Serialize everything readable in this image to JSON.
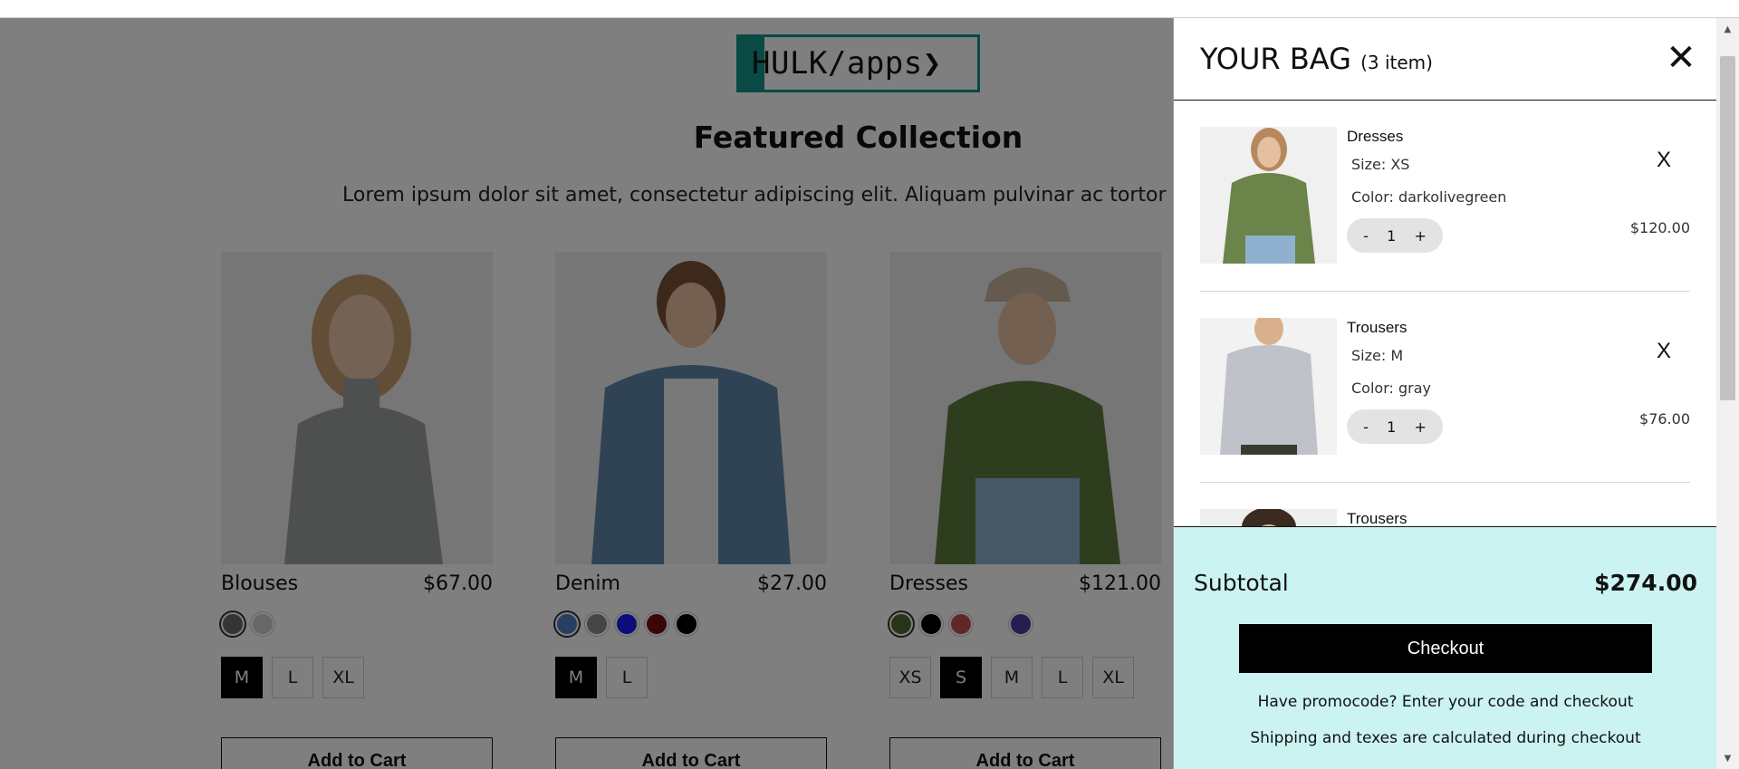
{
  "brand": {
    "logo_text": "HULK/apps❯"
  },
  "collection": {
    "title": "Featured Collection",
    "description": "Lorem ipsum dolor sit amet, consectetur adipiscing elit. Aliquam pulvinar ac tortor i"
  },
  "products": [
    {
      "name": "Blouses",
      "price": "$67.00",
      "swatches": [
        "#6b6b6b",
        "#cfcfcf"
      ],
      "selected_swatch": 0,
      "sizes": [
        "M",
        "L",
        "XL"
      ],
      "active_size": 0,
      "add_label": "Add to Cart"
    },
    {
      "name": "Denim",
      "price": "$27.00",
      "swatches": [
        "#4f7fc3",
        "#8a8a8a",
        "#1c17f5",
        "#7a0c0c",
        "#000000"
      ],
      "selected_swatch": 0,
      "sizes": [
        "M",
        "L"
      ],
      "active_size": 0,
      "add_label": "Add to Cart"
    },
    {
      "name": "Dresses",
      "price": "$121.00",
      "swatches": [
        "#4d6b2c",
        "#000000",
        "#c45050",
        "#ffffff",
        "#4a3c9c"
      ],
      "selected_swatch": 0,
      "sizes": [
        "XS",
        "S",
        "M",
        "L",
        "XL"
      ],
      "active_size": 1,
      "add_label": "Add to Cart"
    }
  ],
  "cart": {
    "title": "YOUR BAG",
    "count_label": "(3 item)",
    "close_glyph": "✕",
    "remove_glyph": "X",
    "items": [
      {
        "name": "Dresses",
        "size": "Size: XS",
        "color": "Color: darkolivegreen",
        "qty": "1",
        "price": "$120.00",
        "image": "green-shirt"
      },
      {
        "name": "Trousers",
        "size": "Size: M",
        "color": "Color: gray",
        "qty": "1",
        "price": "$76.00",
        "image": "gray-shirt"
      },
      {
        "name": "Trousers",
        "size": "",
        "color": "",
        "qty": "",
        "price": "",
        "image": "model-portrait"
      }
    ],
    "qty_minus": "-",
    "qty_plus": "+",
    "subtotal_label": "Subtotal",
    "subtotal_value": "$274.00",
    "checkout_label": "Checkout",
    "promo_text": "Have promocode? Enter your code and checkout",
    "shipping_text": "Shipping and texes are calculated during checkout"
  },
  "colors": {
    "accent": "#129489",
    "cart_footer_bg": "#cbf3f1",
    "overlay": "rgba(0,0,0,0.5)"
  }
}
